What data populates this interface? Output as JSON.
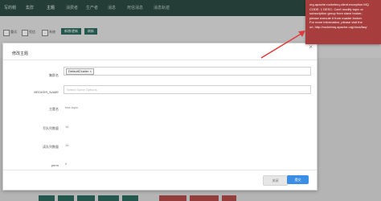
{
  "nav": {
    "brand": "写的帽",
    "items": [
      {
        "label": "集群",
        "active": false
      },
      {
        "label": "主题",
        "active": true
      },
      {
        "label": "消费者",
        "active": false
      },
      {
        "label": "生产者",
        "active": false
      },
      {
        "label": "消息",
        "active": false
      },
      {
        "label": "死信消息",
        "active": false
      },
      {
        "label": "消息轨迹",
        "active": false
      }
    ]
  },
  "filters": {
    "checkboxes": [
      "重试",
      "死信",
      "系统"
    ],
    "buttons": [
      "新增/更新",
      "刷新"
    ]
  },
  "modal": {
    "title": "修改主题",
    "close_icon": "×",
    "fields": {
      "cluster": {
        "label": "集群名",
        "tag": "DefaultCluster",
        "tag_remove": "×"
      },
      "broker": {
        "label": "BROKER_NAME",
        "placeholder": "Select Some Options"
      },
      "topic": {
        "label": "主题名",
        "value": "test-topic"
      },
      "write_queues": {
        "label": "写队列数量",
        "value": "16"
      },
      "read_queues": {
        "label": "读队列数量",
        "value": "16"
      },
      "perm": {
        "label": "perm",
        "value": "6"
      }
    },
    "buttons": {
      "close": "关闭",
      "confirm": "提交"
    }
  },
  "toast": {
    "text": "org.apache.rocketmq.client.exception.MQ\nCODE: 1 DESC: Can't modify topic or\nsubscription group from slave broker,\nplease execute it from master broker.\nFor more information, please visit the\nurl, http://rocketmq.apache.org/docs/faq/"
  },
  "colors": {
    "nav_bg": "#2d4b42",
    "toast_bg": "#a83d3d",
    "primary": "#3b8ee6",
    "arrow": "#e03c3c"
  }
}
